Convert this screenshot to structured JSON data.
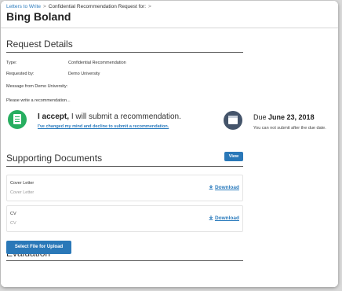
{
  "breadcrumb": {
    "link_label": "Letters to Write",
    "separator": ">",
    "current_label": "Confidential Recommendation Request for:"
  },
  "page_title": "Bing Boland",
  "request_details": {
    "heading": "Request Details",
    "type_label": "Type:",
    "type_value": "Confidential Recommendation",
    "requested_by_label": "Requested by:",
    "requested_by_value": "Demo University",
    "message_label": "Message from Demo University:",
    "message_text": "Please write a recommendation..."
  },
  "accept": {
    "icon": "document-icon",
    "bold": "I accept,",
    "rest": "I will submit a recommendation.",
    "decline_link": "I've changed my mind and decline to submit a recommendation."
  },
  "due": {
    "icon": "calendar-icon",
    "label": "Due",
    "date": "June 23, 2018",
    "note": "You can not submit after the due date."
  },
  "supporting_documents": {
    "heading": "Supporting Documents",
    "view_label": "View",
    "documents": [
      {
        "title": "Cover Letter",
        "subtitle": "Cover Letter",
        "action": "Download"
      },
      {
        "title": "CV",
        "subtitle": "CV",
        "action": "Download"
      }
    ]
  },
  "evaluation": {
    "heading": "Evaluation",
    "upload_label": "Select File for Upload"
  },
  "colors": {
    "accent": "#2a78b8",
    "link": "#2b7bbd",
    "success": "#27ae60",
    "calendar": "#44546a"
  }
}
